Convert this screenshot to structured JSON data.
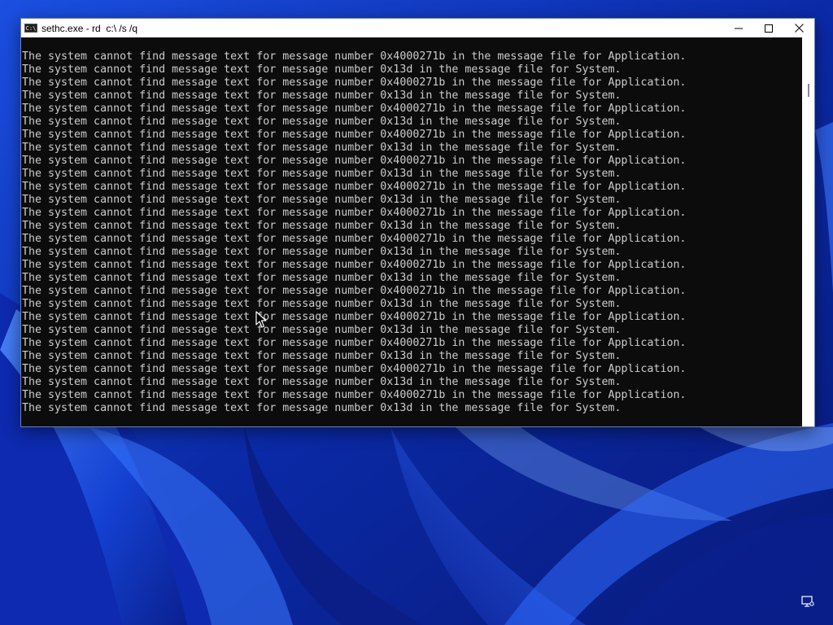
{
  "desktop": {
    "wallpaper_colors": {
      "deep": "#0a1f8c",
      "mid": "#1544d6",
      "light": "#3d7cff",
      "glow": "#9ec4ff"
    },
    "tray_icon": "network-monitor-icon"
  },
  "window": {
    "title": "sethc.exe - rd  c:\\ /s /q",
    "app_icon": "console-app-icon",
    "app_icon_text": "C:\\",
    "controls": {
      "minimize_icon": "minimize-icon",
      "maximize_icon": "maximize-icon",
      "close_icon": "close-icon"
    },
    "colors": {
      "console_bg": "#0c0c0c",
      "console_text": "#cccccc",
      "title_bg": "#ffffff"
    }
  },
  "console": {
    "lines": [
      "The system cannot find message text for message number 0x4000271b in the message file for Application.",
      "The system cannot find message text for message number 0x13d in the message file for System.",
      "The system cannot find message text for message number 0x4000271b in the message file for Application.",
      "The system cannot find message text for message number 0x13d in the message file for System.",
      "The system cannot find message text for message number 0x4000271b in the message file for Application.",
      "The system cannot find message text for message number 0x13d in the message file for System.",
      "The system cannot find message text for message number 0x4000271b in the message file for Application.",
      "The system cannot find message text for message number 0x13d in the message file for System.",
      "The system cannot find message text for message number 0x4000271b in the message file for Application.",
      "The system cannot find message text for message number 0x13d in the message file for System.",
      "The system cannot find message text for message number 0x4000271b in the message file for Application.",
      "The system cannot find message text for message number 0x13d in the message file for System.",
      "The system cannot find message text for message number 0x4000271b in the message file for Application.",
      "The system cannot find message text for message number 0x13d in the message file for System.",
      "The system cannot find message text for message number 0x4000271b in the message file for Application.",
      "The system cannot find message text for message number 0x13d in the message file for System.",
      "The system cannot find message text for message number 0x4000271b in the message file for Application.",
      "The system cannot find message text for message number 0x13d in the message file for System.",
      "The system cannot find message text for message number 0x4000271b in the message file for Application.",
      "The system cannot find message text for message number 0x13d in the message file for System.",
      "The system cannot find message text for message number 0x4000271b in the message file for Application.",
      "The system cannot find message text for message number 0x13d in the message file for System.",
      "The system cannot find message text for message number 0x4000271b in the message file for Application.",
      "The system cannot find message text for message number 0x13d in the message file for System.",
      "The system cannot find message text for message number 0x4000271b in the message file for Application.",
      "The system cannot find message text for message number 0x13d in the message file for System.",
      "The system cannot find message text for message number 0x4000271b in the message file for Application.",
      "The system cannot find message text for message number 0x13d in the message file for System."
    ]
  }
}
